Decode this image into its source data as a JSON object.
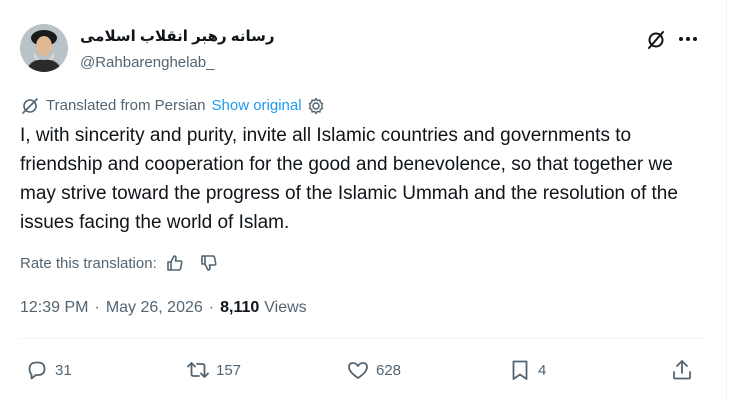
{
  "account": {
    "display_name": "رسانه رهبر انقلاب اسلامی",
    "handle": "@Rahbarenghelab_"
  },
  "translation": {
    "label": "Translated from Persian",
    "show_original": "Show original",
    "rate_label": "Rate this translation:"
  },
  "tweet": {
    "text": "I, with sincerity and purity, invite all Islamic countries and governments to friendship and cooperation for the good and benevolence, so that together we may strive toward the progress of the Islamic Ummah and the resolution of the issues facing the world of Islam."
  },
  "meta": {
    "time": "12:39 PM",
    "separator": "·",
    "date": "May 26, 2026",
    "views_count": "8,110",
    "views_label": "Views"
  },
  "actions": {
    "replies": "31",
    "reposts": "157",
    "likes": "628",
    "bookmarks": "4"
  },
  "colors": {
    "accent": "#1d9bf0",
    "secondary_text": "#536471",
    "primary_text": "#0f1419",
    "divider": "#eff3f4"
  },
  "icons": [
    "avatar",
    "grok-icon",
    "more-icon",
    "translate-icon",
    "gear-icon",
    "thumbs-up-icon",
    "thumbs-down-icon",
    "reply-icon",
    "repost-icon",
    "like-icon",
    "bookmark-icon",
    "share-icon"
  ]
}
